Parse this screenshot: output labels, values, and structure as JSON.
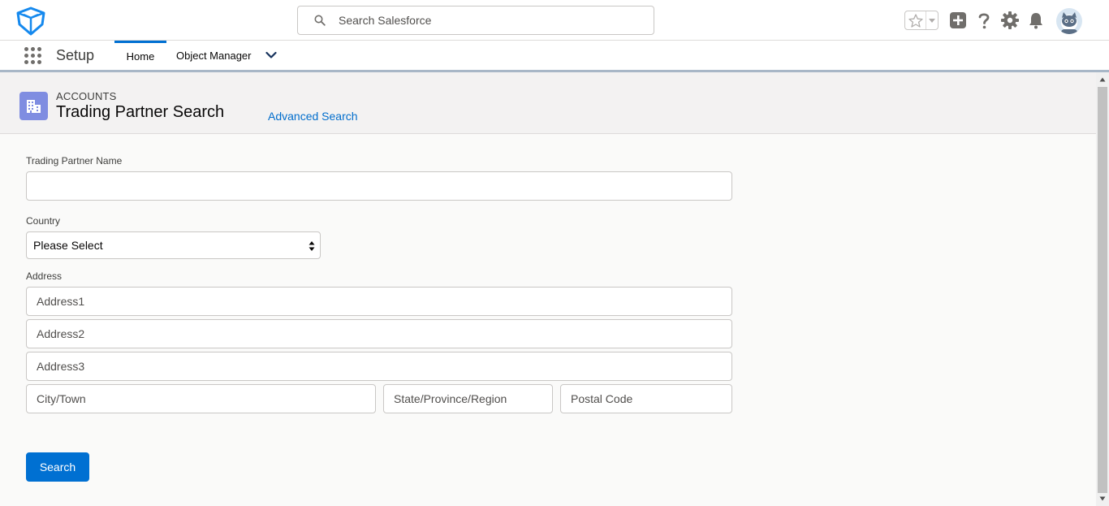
{
  "header": {
    "search_placeholder": "Search Salesforce"
  },
  "context": {
    "app_name": "Setup",
    "tabs": [
      {
        "label": "Home",
        "active": true
      },
      {
        "label": "Object Manager",
        "active": false
      }
    ]
  },
  "page": {
    "object_label": "ACCOUNTS",
    "title": "Trading Partner Search",
    "advanced_search_link": "Advanced Search"
  },
  "form": {
    "name_label": "Trading Partner Name",
    "name_value": "",
    "country_label": "Country",
    "country_selected": "Please Select",
    "address_label": "Address",
    "address1_placeholder": "Address1",
    "address2_placeholder": "Address2",
    "address3_placeholder": "Address3",
    "city_placeholder": "City/Town",
    "state_placeholder": "State/Province/Region",
    "postal_placeholder": "Postal Code",
    "search_button": "Search"
  },
  "colors": {
    "brand_blue": "#0070d2",
    "link_blue": "#006dcc",
    "object_icon": "#7f8de1"
  }
}
